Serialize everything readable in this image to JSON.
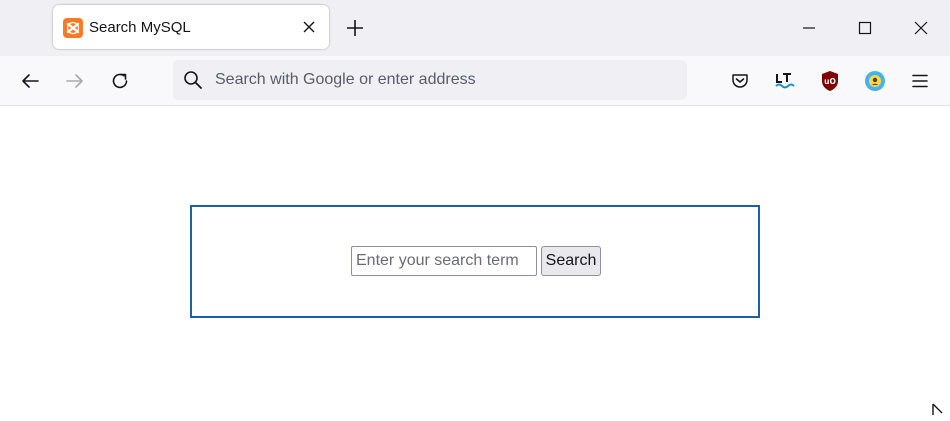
{
  "tab": {
    "title": "Search MySQL",
    "favicon_color": "#fb7a24"
  },
  "url_bar": {
    "placeholder": "Search with Google or enter address"
  },
  "toolbar_icons": [
    "pocket-icon",
    "languagetool-icon",
    "ublock-origin-icon",
    "extension-icon",
    "hamburger-menu-icon"
  ],
  "form": {
    "input_placeholder": "Enter your search term",
    "input_value": "",
    "button_label": "Search",
    "border_color": "#1f5fa8"
  }
}
